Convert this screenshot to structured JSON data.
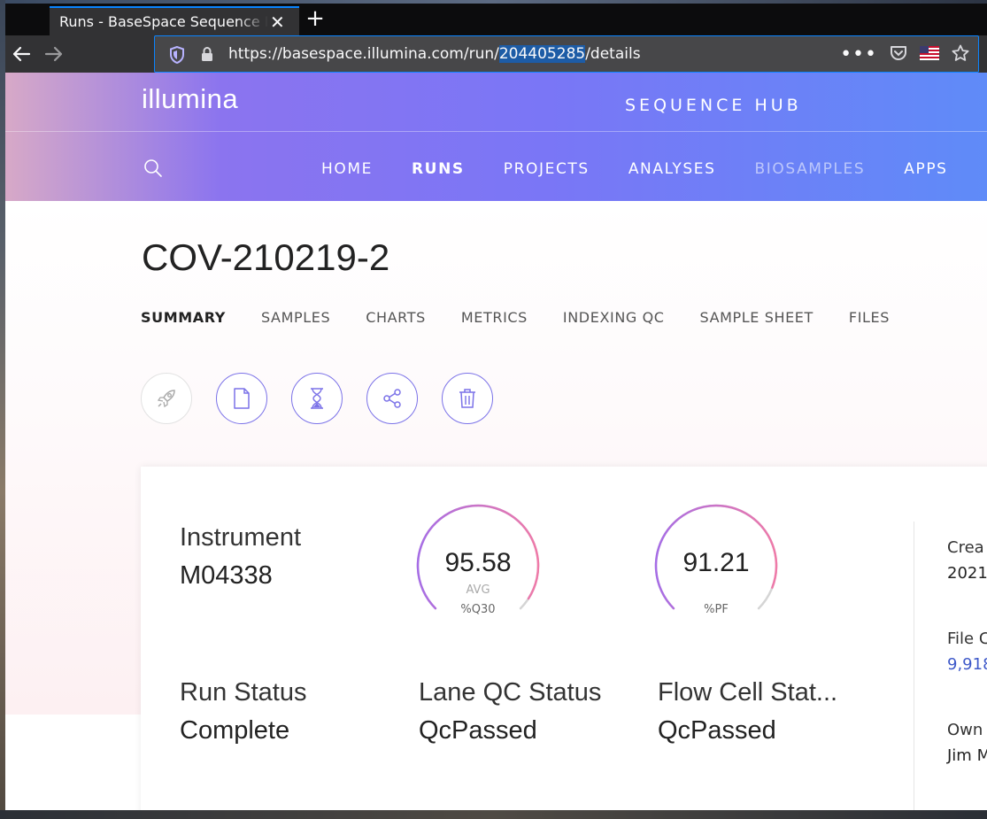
{
  "browser": {
    "tab_title": "Runs - BaseSpace Sequence Hub",
    "url_prefix": "https://basespace.illumina.com/run/",
    "url_selected": "204405285",
    "url_suffix": "/details"
  },
  "header": {
    "logo": "illumina",
    "product": "SEQUENCE HUB",
    "nav": [
      "HOME",
      "RUNS",
      "PROJECTS",
      "ANALYSES",
      "BIOSAMPLES",
      "APPS"
    ]
  },
  "run": {
    "title": "COV-210219-2",
    "tabs": [
      "SUMMARY",
      "SAMPLES",
      "CHARTS",
      "METRICS",
      "INDEXING QC",
      "SAMPLE SHEET",
      "FILES"
    ]
  },
  "summary": {
    "instrument_label": "Instrument",
    "instrument_value": "M04338",
    "q30": {
      "value": "95.58",
      "sub": "AVG",
      "caption": "%Q30",
      "fraction": 0.9558
    },
    "pf": {
      "value": "91.21",
      "caption": "%PF",
      "fraction": 0.9121
    },
    "run_status_label": "Run Status",
    "run_status_value": "Complete",
    "lane_qc_label": "Lane QC Status",
    "lane_qc_value": "QcPassed",
    "flow_cell_label": "Flow Cell Stat...",
    "flow_cell_value": "QcPassed",
    "side": {
      "created_label": "Crea",
      "created_value": "2021",
      "file_label": "File C",
      "file_value": "9,918",
      "owner_label": "Own",
      "owner_value": "Jim M"
    }
  },
  "colors": {
    "accent": "#7b72e8",
    "link": "#3e59c9",
    "browser_focus": "#0a84ff"
  }
}
